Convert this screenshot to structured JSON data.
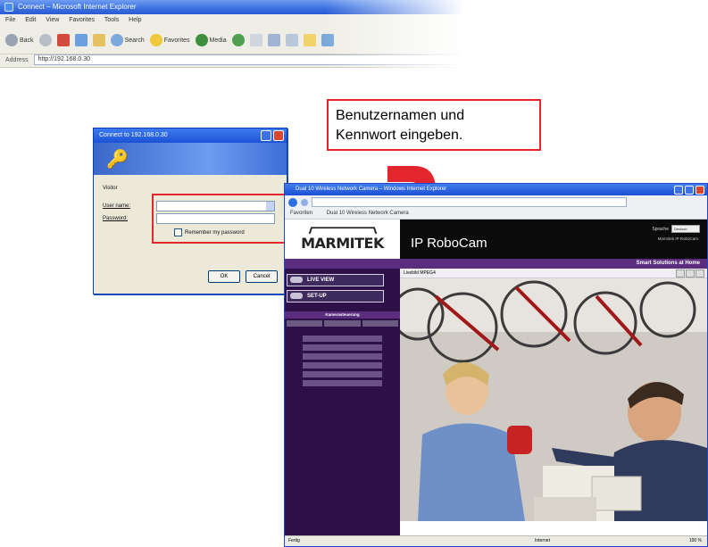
{
  "background_browser": {
    "title": "Connect – Microsoft Internet Explorer",
    "menu": [
      "File",
      "Edit",
      "View",
      "Favorites",
      "Tools",
      "Help"
    ],
    "toolbar": {
      "back": "Back",
      "search": "Search",
      "favorites": "Favorites",
      "media": "Media"
    },
    "address_label": "Address",
    "address_value": "http://192.168.0.30"
  },
  "login_dialog": {
    "title": "Connect to 192.168.0.30",
    "realm_label": "Visitor",
    "username_label": "User name:",
    "username_value": "",
    "password_label": "Password:",
    "password_value": "",
    "remember_label": "Remember my password",
    "ok_label": "OK",
    "cancel_label": "Cancel"
  },
  "callout": {
    "line1": "Benutzernamen und",
    "line2": "Kennwort eingeben."
  },
  "colors": {
    "highlight_red": "#e3262d",
    "arrow_red": "#e3262d",
    "brand_purple": "#5a2d7e",
    "sidebar_dark": "#2e1048"
  },
  "foreground_browser": {
    "title": "Dual 10 Wireless Network Camera – Windows Internet Explorer",
    "favorites_bar": [
      "Favoriten",
      "Dual 10 Wireless Network Camera"
    ],
    "page": {
      "brand": "MARMITEK",
      "product": "IP RoboCam",
      "system_label": "Sprache",
      "language_value": "Deutsch",
      "info_line1": "Marmitek IP RoboCam",
      "info_line2": "",
      "slogan": "Smart Solutions at Home",
      "live_view": "LIVE VIEW",
      "setup": "SET-UP",
      "ptz_title": "Kamerasteuerung",
      "ptz_buttons": [
        "",
        "",
        ""
      ],
      "menu_items": [
        "",
        "",
        "",
        "",
        "",
        ""
      ],
      "stream_label": "Livebild MPEG4"
    },
    "status": {
      "left": "Fertig",
      "middle": "Internet",
      "right": "100 %"
    }
  }
}
